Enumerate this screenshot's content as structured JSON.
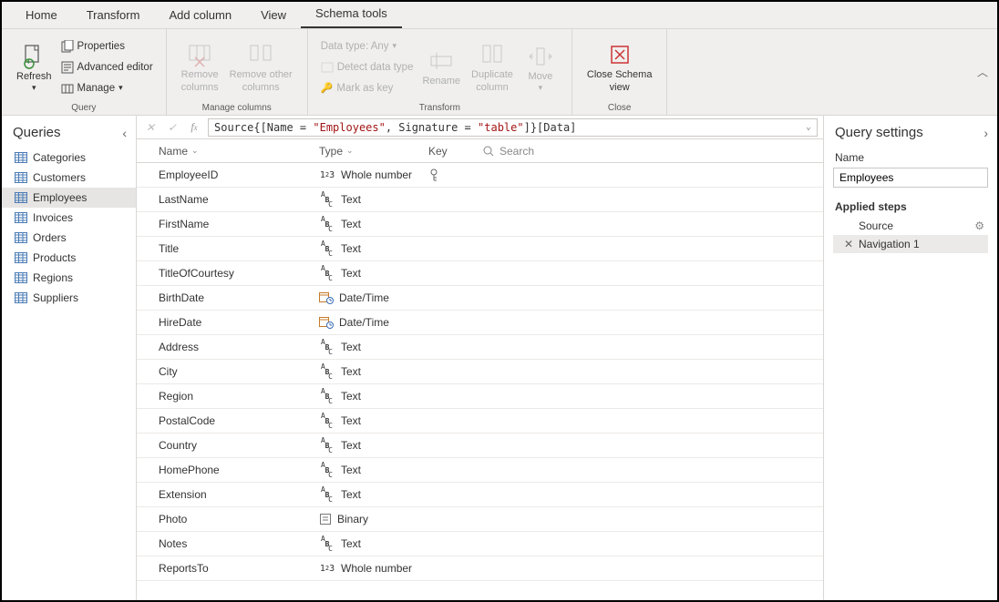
{
  "tabs": {
    "home": "Home",
    "transform": "Transform",
    "add_column": "Add column",
    "view": "View",
    "schema_tools": "Schema tools"
  },
  "ribbon": {
    "refresh": "Refresh",
    "properties": "Properties",
    "advanced_editor": "Advanced editor",
    "manage": "Manage",
    "group_query": "Query",
    "remove_columns": "Remove\ncolumns",
    "remove_other_columns": "Remove other\ncolumns",
    "group_manage_columns": "Manage columns",
    "data_type": "Data type: Any",
    "detect_data_type": "Detect data type",
    "mark_as_key": "Mark as key",
    "rename": "Rename",
    "duplicate_column": "Duplicate\ncolumn",
    "move": "Move",
    "group_transform": "Transform",
    "close_schema_view": "Close Schema\nview",
    "group_close": "Close"
  },
  "formula": {
    "prefix": "Source{[Name = ",
    "q1": "\"Employees\"",
    "mid": ", Signature = ",
    "q2": "\"table\"",
    "suffix": "]}[Data]"
  },
  "queries": {
    "title": "Queries",
    "items": [
      "Categories",
      "Customers",
      "Employees",
      "Invoices",
      "Orders",
      "Products",
      "Regions",
      "Suppliers"
    ],
    "selected": "Employees"
  },
  "schema": {
    "col_name": "Name",
    "col_type": "Type",
    "col_key": "Key",
    "search_placeholder": "Search",
    "rows": [
      {
        "name": "EmployeeID",
        "type": "Whole number",
        "icon": "num",
        "key": true
      },
      {
        "name": "LastName",
        "type": "Text",
        "icon": "abc"
      },
      {
        "name": "FirstName",
        "type": "Text",
        "icon": "abc"
      },
      {
        "name": "Title",
        "type": "Text",
        "icon": "abc"
      },
      {
        "name": "TitleOfCourtesy",
        "type": "Text",
        "icon": "abc"
      },
      {
        "name": "BirthDate",
        "type": "Date/Time",
        "icon": "date"
      },
      {
        "name": "HireDate",
        "type": "Date/Time",
        "icon": "date"
      },
      {
        "name": "Address",
        "type": "Text",
        "icon": "abc"
      },
      {
        "name": "City",
        "type": "Text",
        "icon": "abc"
      },
      {
        "name": "Region",
        "type": "Text",
        "icon": "abc"
      },
      {
        "name": "PostalCode",
        "type": "Text",
        "icon": "abc"
      },
      {
        "name": "Country",
        "type": "Text",
        "icon": "abc"
      },
      {
        "name": "HomePhone",
        "type": "Text",
        "icon": "abc"
      },
      {
        "name": "Extension",
        "type": "Text",
        "icon": "abc"
      },
      {
        "name": "Photo",
        "type": "Binary",
        "icon": "bin"
      },
      {
        "name": "Notes",
        "type": "Text",
        "icon": "abc"
      },
      {
        "name": "ReportsTo",
        "type": "Whole number",
        "icon": "num"
      }
    ]
  },
  "settings": {
    "title": "Query settings",
    "name_label": "Name",
    "name_value": "Employees",
    "applied_steps_label": "Applied steps",
    "steps": [
      {
        "label": "Source",
        "gear": true,
        "x": false
      },
      {
        "label": "Navigation 1",
        "gear": false,
        "x": true,
        "selected": true
      }
    ]
  }
}
